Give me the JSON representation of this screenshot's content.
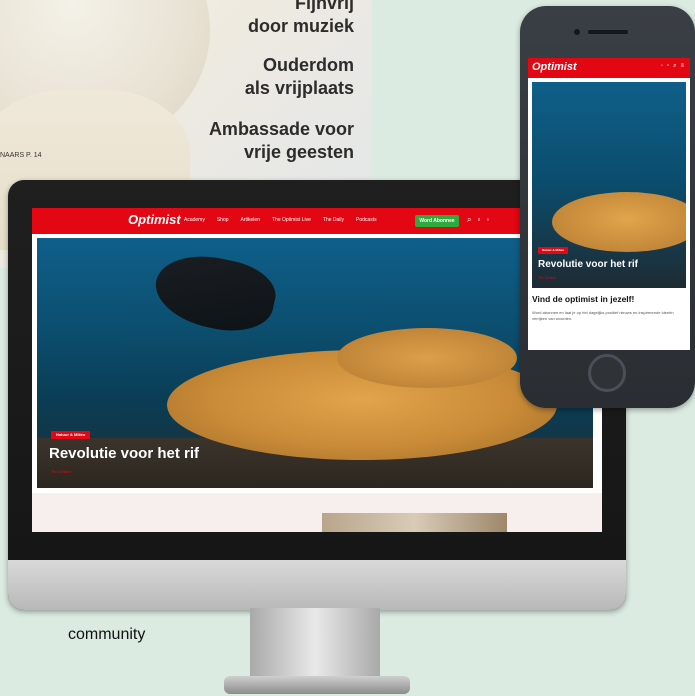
{
  "magazine": {
    "headlines": [
      "Fijnvrij",
      "door muziek",
      "Ouderdom",
      "als vrijplaats",
      "Ambassade voor",
      "vrije geesten"
    ],
    "page_ref": "NAARS P. 14"
  },
  "desktop": {
    "logo": "Optimist",
    "nav": [
      "Academy",
      "Shop",
      "Artikelen",
      "The Optimist Live",
      "The Daily",
      "Podcasts"
    ],
    "cta": "Word Abonnee",
    "hero": {
      "badge": "Natuur & Milieu",
      "title": "Revolutie voor het rif",
      "subtitle": "Tim Dekker"
    }
  },
  "mobile": {
    "logo": "Optimist",
    "hero": {
      "badge": "Natuur & Milieu",
      "title": "Revolutie voor het rif",
      "subtitle": "Tim Dekker"
    },
    "heading": "Vind de optimist in jezelf!",
    "body": "Word abonnee en laat je op het dagelijks positief nieuws en inspirerende ideeën verrijken van woorden."
  },
  "caption": "community",
  "colors": {
    "brand_red": "#e30613",
    "cta_green": "#2eab3c",
    "background": "#dcebe2"
  },
  "icons": [
    "search-icon",
    "cart-icon",
    "user-icon",
    "menu-icon"
  ]
}
